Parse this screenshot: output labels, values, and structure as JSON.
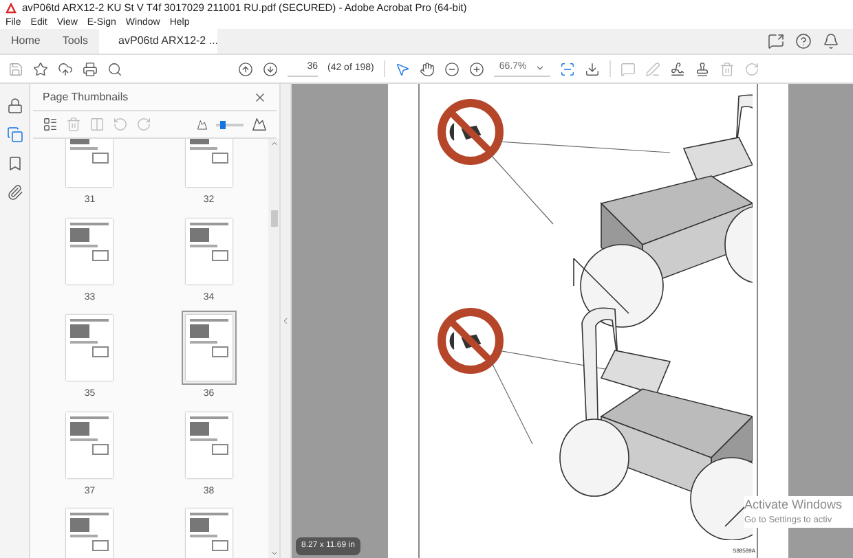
{
  "window": {
    "title": "avP06td ARX12-2 KU St V T4f 3017029 211001 RU.pdf (SECURED) - Adobe Acrobat Pro (64-bit)"
  },
  "menu": [
    "File",
    "Edit",
    "View",
    "E-Sign",
    "Window",
    "Help"
  ],
  "tabs": [
    {
      "label": "Home",
      "selected": false
    },
    {
      "label": "Tools",
      "selected": false
    },
    {
      "label": "avP06td ARX12-2 ...",
      "selected": true
    }
  ],
  "toolbar": {
    "page_number": "36",
    "page_count": "(42 of 198)",
    "zoom": "66.7%"
  },
  "thumbnail_panel": {
    "title": "Page Thumbnails",
    "size_slider": {
      "level": 0.2
    },
    "thumbnails": [
      {
        "label": "31",
        "selected": false
      },
      {
        "label": "32",
        "selected": false
      },
      {
        "label": "33",
        "selected": false
      },
      {
        "label": "34",
        "selected": false
      },
      {
        "label": "35",
        "selected": false
      },
      {
        "label": "36",
        "selected": true
      },
      {
        "label": "37",
        "selected": false
      },
      {
        "label": "38",
        "selected": false
      },
      {
        "selected": false
      },
      {
        "selected": false
      }
    ]
  },
  "document": {
    "figure_code": "S88589A",
    "page_size": "8.27 x 11.69 in"
  },
  "os_notice": [
    "Activate Windows",
    "Go to Settings to activ"
  ]
}
